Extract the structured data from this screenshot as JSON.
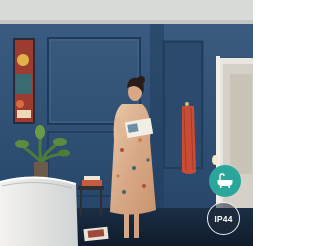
{
  "image": {
    "description_colors": {
      "wall": "#2f4f73",
      "wall_dark": "#223d5c",
      "ceiling": "#d9dcd8",
      "bath_badge": "#2aa79a",
      "ip_badge_ring": "#e8eef2"
    }
  },
  "badges": {
    "bathroom": {
      "icon": "bathtub-icon"
    },
    "ip_rating": {
      "label": "IP44"
    }
  }
}
